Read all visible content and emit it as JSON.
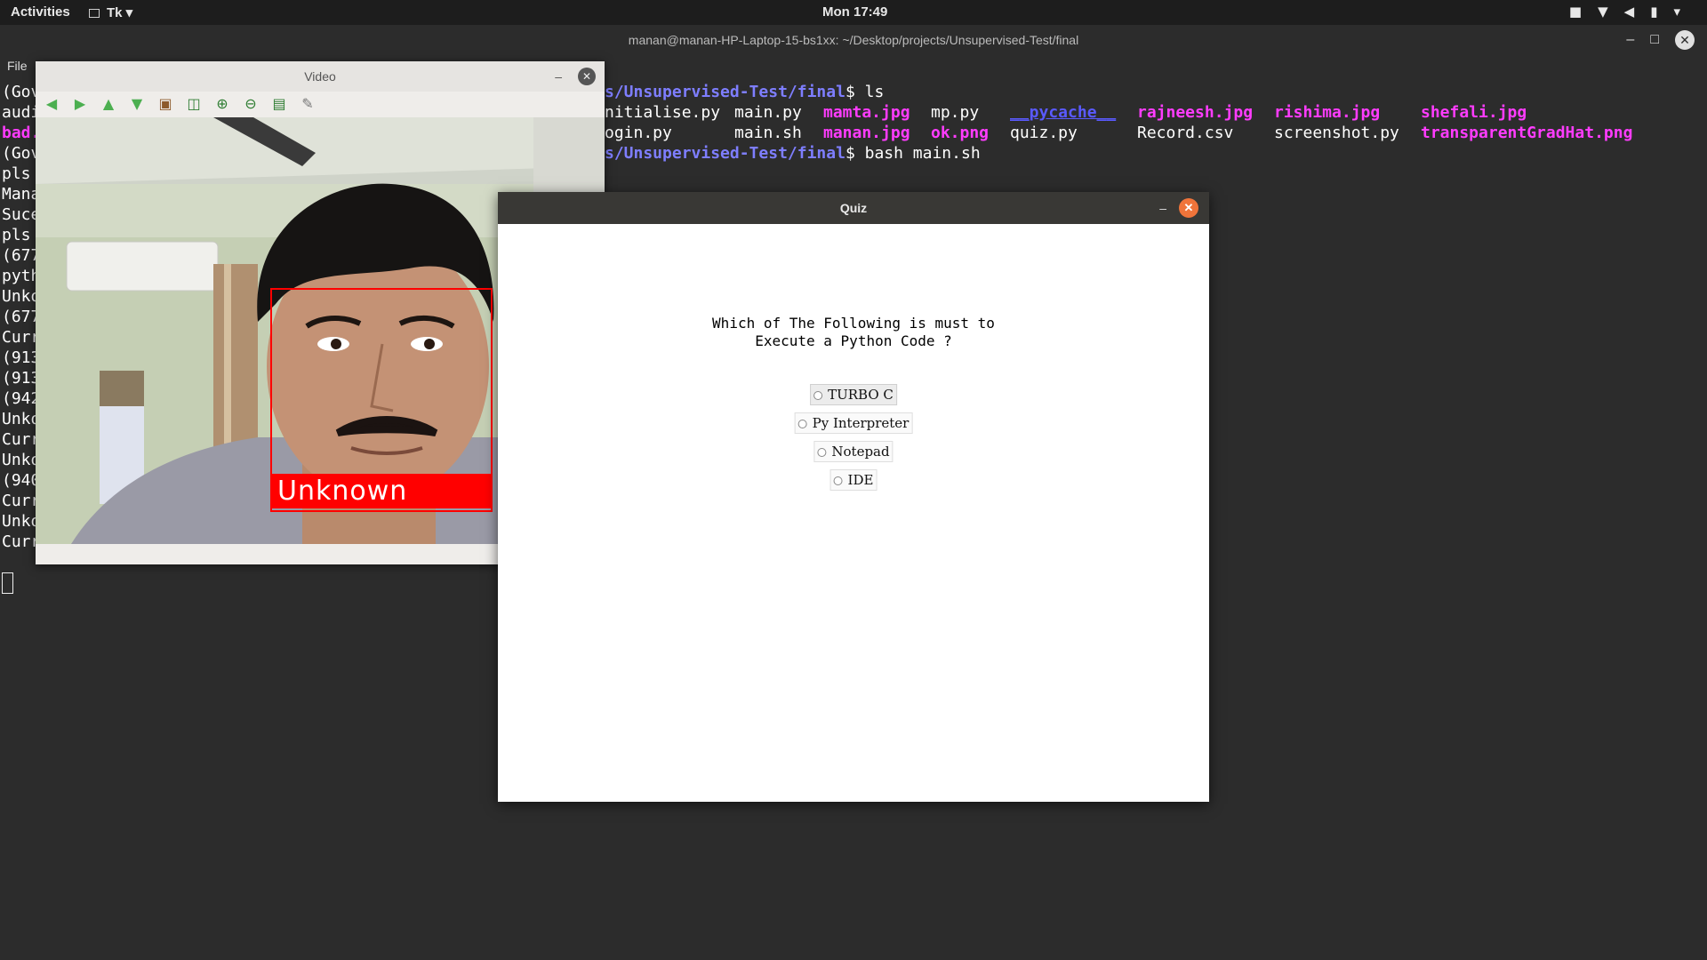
{
  "topbar": {
    "activities": "Activities",
    "app_menu": "Tk",
    "clock": "Mon 17:49"
  },
  "terminal": {
    "title": "manan@manan-HP-Laptop-15-bs1xx: ~/Desktop/projects/Unsupervised-Test/final",
    "menu_file": "File",
    "prompt1_path": "s/Unsupervised-Test/final",
    "prompt1_cmd": "$ ls",
    "prompt2_path": "s/Unsupervised-Test/final",
    "prompt2_cmd": "$ bash main.sh",
    "ls_row1": {
      "c1": "nitialise.py",
      "c2": "main.py",
      "c3": "mamta.jpg",
      "c4": "mp.py",
      "c5": "__pycache__",
      "c6": "rajneesh.jpg",
      "c7": "rishima.jpg",
      "c8": "shefali.jpg"
    },
    "ls_row2": {
      "c1": "ogin.py",
      "c2": "main.sh",
      "c3": "manan.jpg",
      "c4": "ok.png",
      "c5": "quiz.py",
      "c6": "Record.csv",
      "c7": "screenshot.py",
      "c8": "transparentGradHat.png"
    },
    "left_lines": [
      "(Gov",
      "audi",
      "bad.",
      "(Gov",
      "pls ",
      "Mana",
      "Suce",
      "pls ",
      "(677",
      "pyth",
      "Unko",
      "(677",
      "Curr",
      "(913",
      "(913",
      "(942",
      "Unko",
      "Curr",
      "Unko",
      "(940",
      "Curr",
      "Unko",
      "Curr"
    ]
  },
  "video_window": {
    "title": "Video",
    "face_label": "Unknown"
  },
  "quiz_window": {
    "title": "Quiz",
    "question_line1": "Which of The Following is must to",
    "question_line2": "Execute a Python Code ?",
    "options": [
      "TURBO C",
      "Py Interpreter",
      "Notepad",
      "IDE"
    ]
  },
  "colors": {
    "terminal_bg": "#2c2c2c",
    "prompt": "#7e7eff",
    "image_file": "#ff3cff",
    "directory": "#5a5aff",
    "face_box": "#ff0000",
    "quiz_close": "#f0743a"
  }
}
